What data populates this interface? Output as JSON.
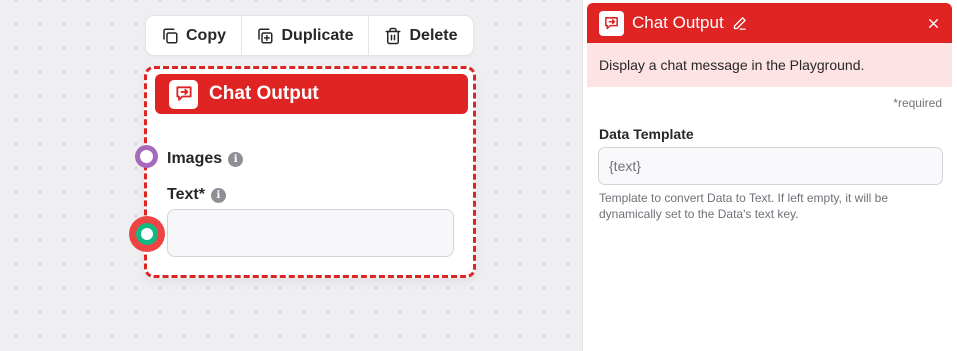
{
  "toolbar": {
    "copy_label": "Copy",
    "duplicate_label": "Duplicate",
    "delete_label": "Delete"
  },
  "node": {
    "title": "Chat Output",
    "fields": {
      "images_label": "Images",
      "text_label": "Text*"
    },
    "accent_color": "#e02424"
  },
  "panel": {
    "title": "Chat Output",
    "description": "Display a chat message in the Playground.",
    "required_note": "*required",
    "data_template": {
      "label": "Data Template",
      "placeholder": "{text}",
      "help": "Template to convert Data to Text. If left empty, it will be dynamically set to the Data's text key."
    }
  },
  "icons": {
    "copy": "copy-icon",
    "duplicate": "duplicate-icon",
    "delete": "trash-icon",
    "chat_output": "chat-output-icon",
    "edit": "pencil-icon",
    "close": "close-icon",
    "info": "info-icon"
  }
}
